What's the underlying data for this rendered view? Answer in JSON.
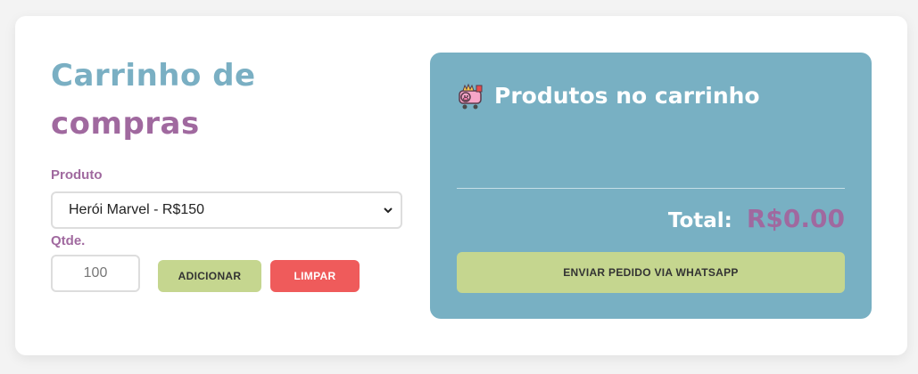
{
  "form": {
    "title_line1": "Carrinho de",
    "title_line2": "compras",
    "product_label": "Produto",
    "product_selected": "Herói Marvel - R$150",
    "qty_label": "Qtde.",
    "qty_placeholder": "100",
    "add_button": "ADICIONAR",
    "clear_button": "LIMPAR"
  },
  "cart": {
    "icon": "pig-cart-icon",
    "title": "Produtos no carrinho",
    "items": [],
    "total_label": "Total:",
    "total_value": "R$0.00",
    "send_button": "ENVIAR PEDIDO VIA WHATSAPP"
  },
  "colors": {
    "blue_accent": "#78b0c3",
    "purple_accent": "#a0699f",
    "green_button": "#c5d68f",
    "red_button": "#ef5b5b"
  }
}
